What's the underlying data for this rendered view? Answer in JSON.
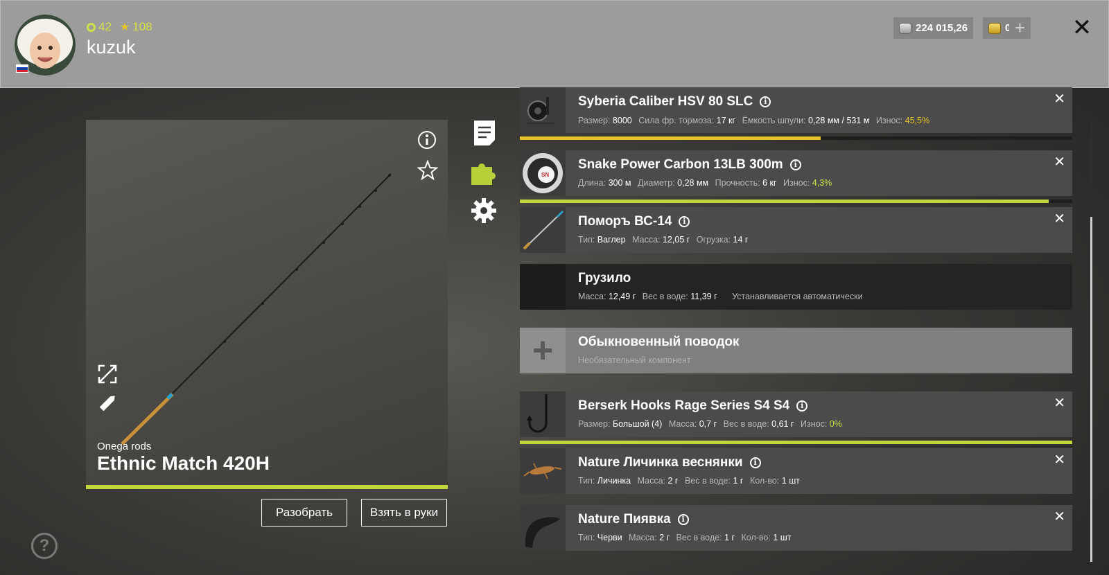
{
  "player": {
    "level": "42",
    "rank": "108",
    "name": "kuzuk",
    "flag": [
      "#ffffff",
      "#1c3fa0",
      "#d5222b"
    ]
  },
  "currency": {
    "silver": "224 015,26",
    "gold": "0",
    "add": "+"
  },
  "close": "✕",
  "rod": {
    "brand": "Onega rods",
    "name": "Ethnic Match 420H",
    "wear": 1.0
  },
  "buttons": {
    "disassemble": "Разобрать",
    "take": "Взять в руки"
  },
  "help": "?",
  "accent_color": "#c0d63b",
  "components": [
    {
      "title": "Syberia Caliber HSV 80 SLC",
      "props": [
        [
          "Размер:",
          "8000"
        ],
        [
          "Сила фр. тормоза:",
          "17 кг"
        ],
        [
          "Ёмкость шпули:",
          "0,28 мм / 531 м"
        ]
      ],
      "wear_label": "Износ:",
      "wear": "45,5%",
      "bar": 0.545,
      "bar_color": "#e6c229"
    },
    {
      "title": "Snake Power Carbon 13LB 300m",
      "props": [
        [
          "Длина:",
          "300 м"
        ],
        [
          "Диаметр:",
          "0,28 мм"
        ],
        [
          "Прочность:",
          "6 кг"
        ]
      ],
      "wear_label": "Износ:",
      "wear": "4,3%",
      "bar": 0.957,
      "bar_color": "#c0d63b"
    },
    {
      "title": "Поморъ ВС-14",
      "props": [
        [
          "Тип:",
          "Ваглер"
        ],
        [
          "Масса:",
          "12,05 г"
        ],
        [
          "Огрузка:",
          "14 г"
        ]
      ]
    },
    {
      "title": "Грузило",
      "props": [
        [
          "Масса:",
          "12,49 г"
        ],
        [
          "Вес в воде:",
          "11,39 г"
        ]
      ],
      "note": "Устанавливается автоматически"
    },
    {
      "title": "Обыкновенный поводок",
      "subtitle": "Необязательный компонент",
      "plus": "+"
    },
    {
      "title": "Berserk Hooks Rage Series S4 S4",
      "props": [
        [
          "Размер:",
          "Большой (4)"
        ],
        [
          "Масса:",
          "0,7 г"
        ],
        [
          "Вес в воде:",
          "0,61 г"
        ]
      ],
      "wear_label": "Износ:",
      "wear": "0%",
      "bar": 1.0,
      "bar_color": "#c0d63b"
    },
    {
      "title": "Nature Личинка веснянки",
      "props": [
        [
          "Тип:",
          "Личинка"
        ],
        [
          "Масса:",
          "2 г"
        ],
        [
          "Вес в воде:",
          "1 г"
        ],
        [
          "Кол-во:",
          "1 шт"
        ]
      ]
    },
    {
      "title": "Nature Пиявка",
      "props": [
        [
          "Тип:",
          "Черви"
        ],
        [
          "Масса:",
          "2 г"
        ],
        [
          "Вес в воде:",
          "1 г"
        ],
        [
          "Кол-во:",
          "1 шт"
        ]
      ]
    }
  ]
}
